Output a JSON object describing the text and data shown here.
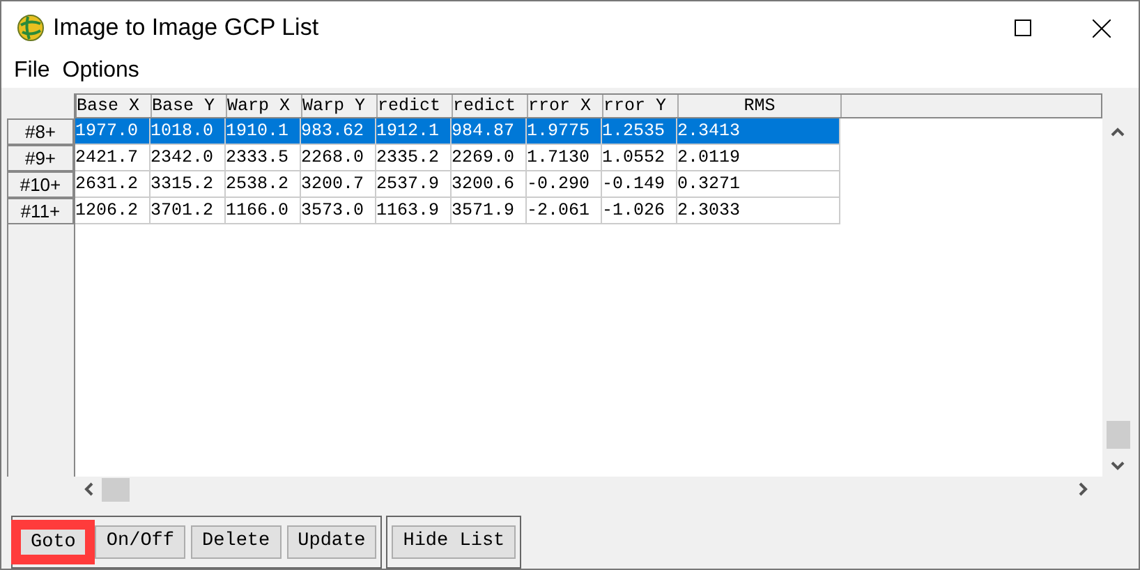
{
  "window": {
    "title": "Image to Image GCP List"
  },
  "menu": [
    "File",
    "Options"
  ],
  "table": {
    "columns": [
      "Base X",
      "Base Y",
      "Warp X",
      "Warp Y",
      "redict",
      "redict",
      "rror X",
      "rror Y",
      "RMS"
    ],
    "rows": [
      {
        "label": "#8+",
        "selected": true,
        "cells": [
          "1977.0",
          "1018.0",
          "1910.1",
          "983.62",
          "1912.1",
          "984.87",
          "1.9775",
          "1.2535",
          "2.3413"
        ]
      },
      {
        "label": "#9+",
        "selected": false,
        "cells": [
          "2421.7",
          "2342.0",
          "2333.5",
          "2268.0",
          "2335.2",
          "2269.0",
          "1.7130",
          "1.0552",
          "2.0119"
        ]
      },
      {
        "label": "#10+",
        "selected": false,
        "cells": [
          "2631.2",
          "3315.2",
          "2538.2",
          "3200.7",
          "2537.9",
          "3200.6",
          "-0.290",
          "-0.149",
          "0.3271"
        ]
      },
      {
        "label": "#11+",
        "selected": false,
        "cells": [
          "1206.2",
          "3701.2",
          "1166.0",
          "3573.0",
          "1163.9",
          "3571.9",
          "-2.061",
          "-1.026",
          "2.3033"
        ]
      }
    ]
  },
  "button_groups": [
    [
      {
        "label": "Goto",
        "highlighted": true
      },
      {
        "label": "On/Off",
        "highlighted": false
      },
      {
        "label": "Delete",
        "highlighted": false
      },
      {
        "label": "Update",
        "highlighted": false
      }
    ],
    [
      {
        "label": "Hide List",
        "highlighted": false
      }
    ]
  ]
}
